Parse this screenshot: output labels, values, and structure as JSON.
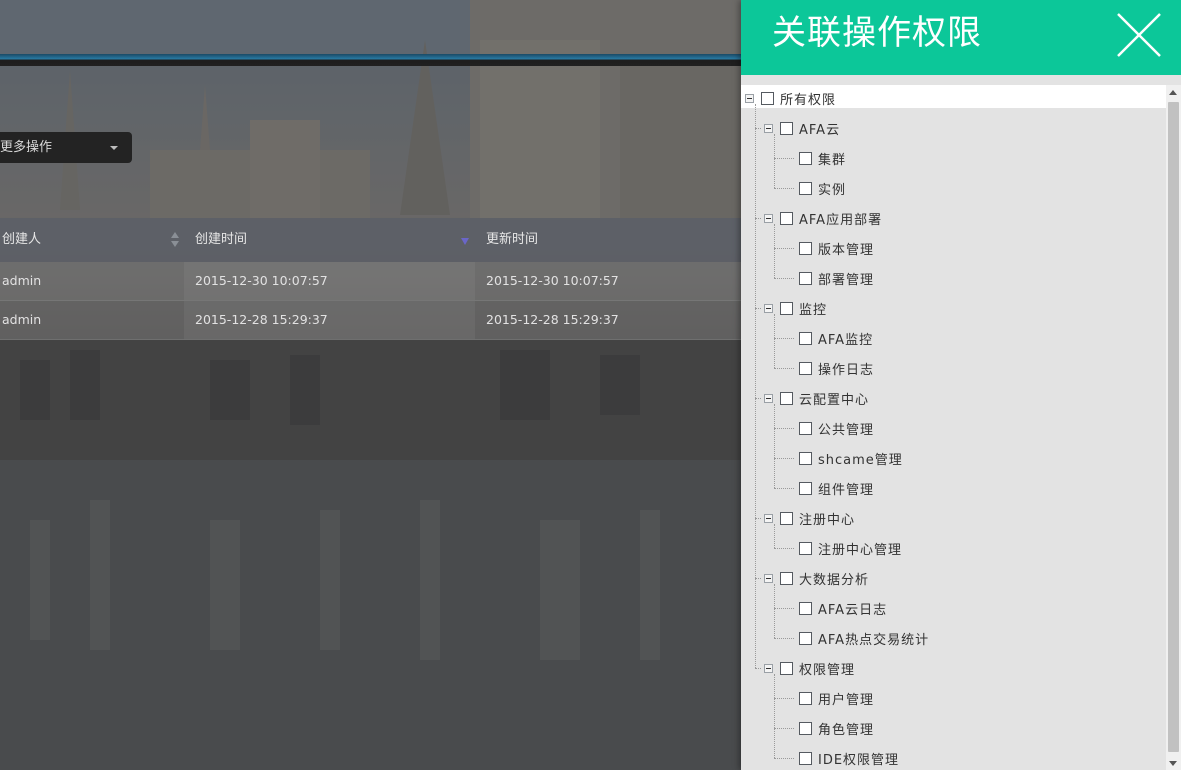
{
  "panel": {
    "title": "关联操作权限",
    "close_icon": "close-x-icon",
    "header_color": "#0cc799"
  },
  "background_page": {
    "more_ops_label": "更多操作",
    "table": {
      "columns": [
        "创建人",
        "创建时间",
        "更新时间"
      ],
      "rows": [
        [
          "admin",
          "2015-12-30 10:07:57",
          "2015-12-30 10:07:57"
        ],
        [
          "admin",
          "2015-12-28 15:29:37",
          "2015-12-28 15:29:37"
        ]
      ]
    }
  },
  "tree": {
    "root": "所有权限",
    "groups": [
      {
        "label": "AFA云",
        "children": [
          "集群",
          "实例"
        ]
      },
      {
        "label": "AFA应用部署",
        "children": [
          "版本管理",
          "部署管理"
        ]
      },
      {
        "label": "监控",
        "children": [
          "AFA监控",
          "操作日志"
        ]
      },
      {
        "label": "云配置中心",
        "children": [
          "公共管理",
          "shcame管理",
          "组件管理"
        ]
      },
      {
        "label": "注册中心",
        "children": [
          "注册中心管理"
        ]
      },
      {
        "label": "大数据分析",
        "children": [
          "AFA云日志",
          "AFA热点交易统计"
        ]
      },
      {
        "label": "权限管理",
        "children": [
          "用户管理",
          "角色管理",
          "IDE权限管理"
        ]
      }
    ]
  }
}
